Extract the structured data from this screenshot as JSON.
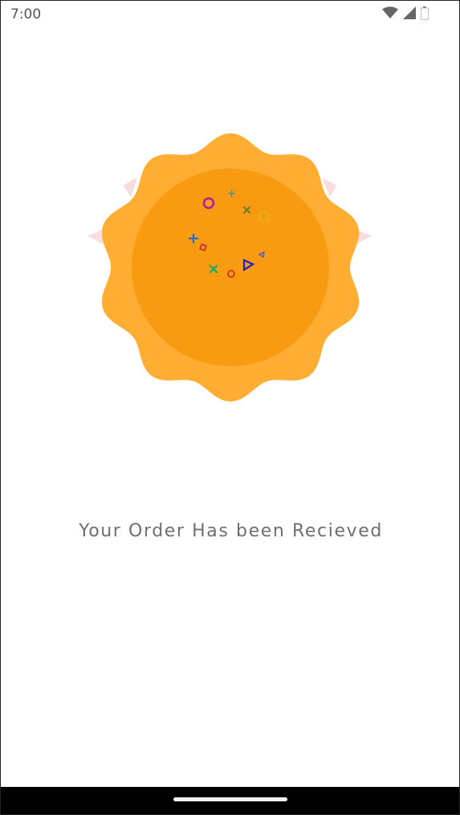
{
  "status_bar": {
    "time": "7:00",
    "icons": [
      "wifi-icon",
      "cellular-signal-icon",
      "battery-icon"
    ]
  },
  "badge": {
    "outer_color": "#FFAD33",
    "inner_color": "#F99B10",
    "ribbon_color": "#F9DCDC",
    "confetti": [
      {
        "shape": "circle",
        "color": "#A020A0"
      },
      {
        "shape": "plus",
        "color": "#5D8A7A"
      },
      {
        "shape": "cross",
        "color": "#6E7A2E"
      },
      {
        "shape": "circle",
        "color": "#D4C020"
      },
      {
        "shape": "plus",
        "color": "#1E6FBE"
      },
      {
        "shape": "square",
        "color": "#C02040"
      },
      {
        "shape": "triangle",
        "color": "#2020C0"
      },
      {
        "shape": "triangle",
        "color": "#5050C0"
      },
      {
        "shape": "cross",
        "color": "#20A860"
      },
      {
        "shape": "circle",
        "color": "#D02020"
      }
    ]
  },
  "message": {
    "text": "Your Order Has been Recieved"
  }
}
